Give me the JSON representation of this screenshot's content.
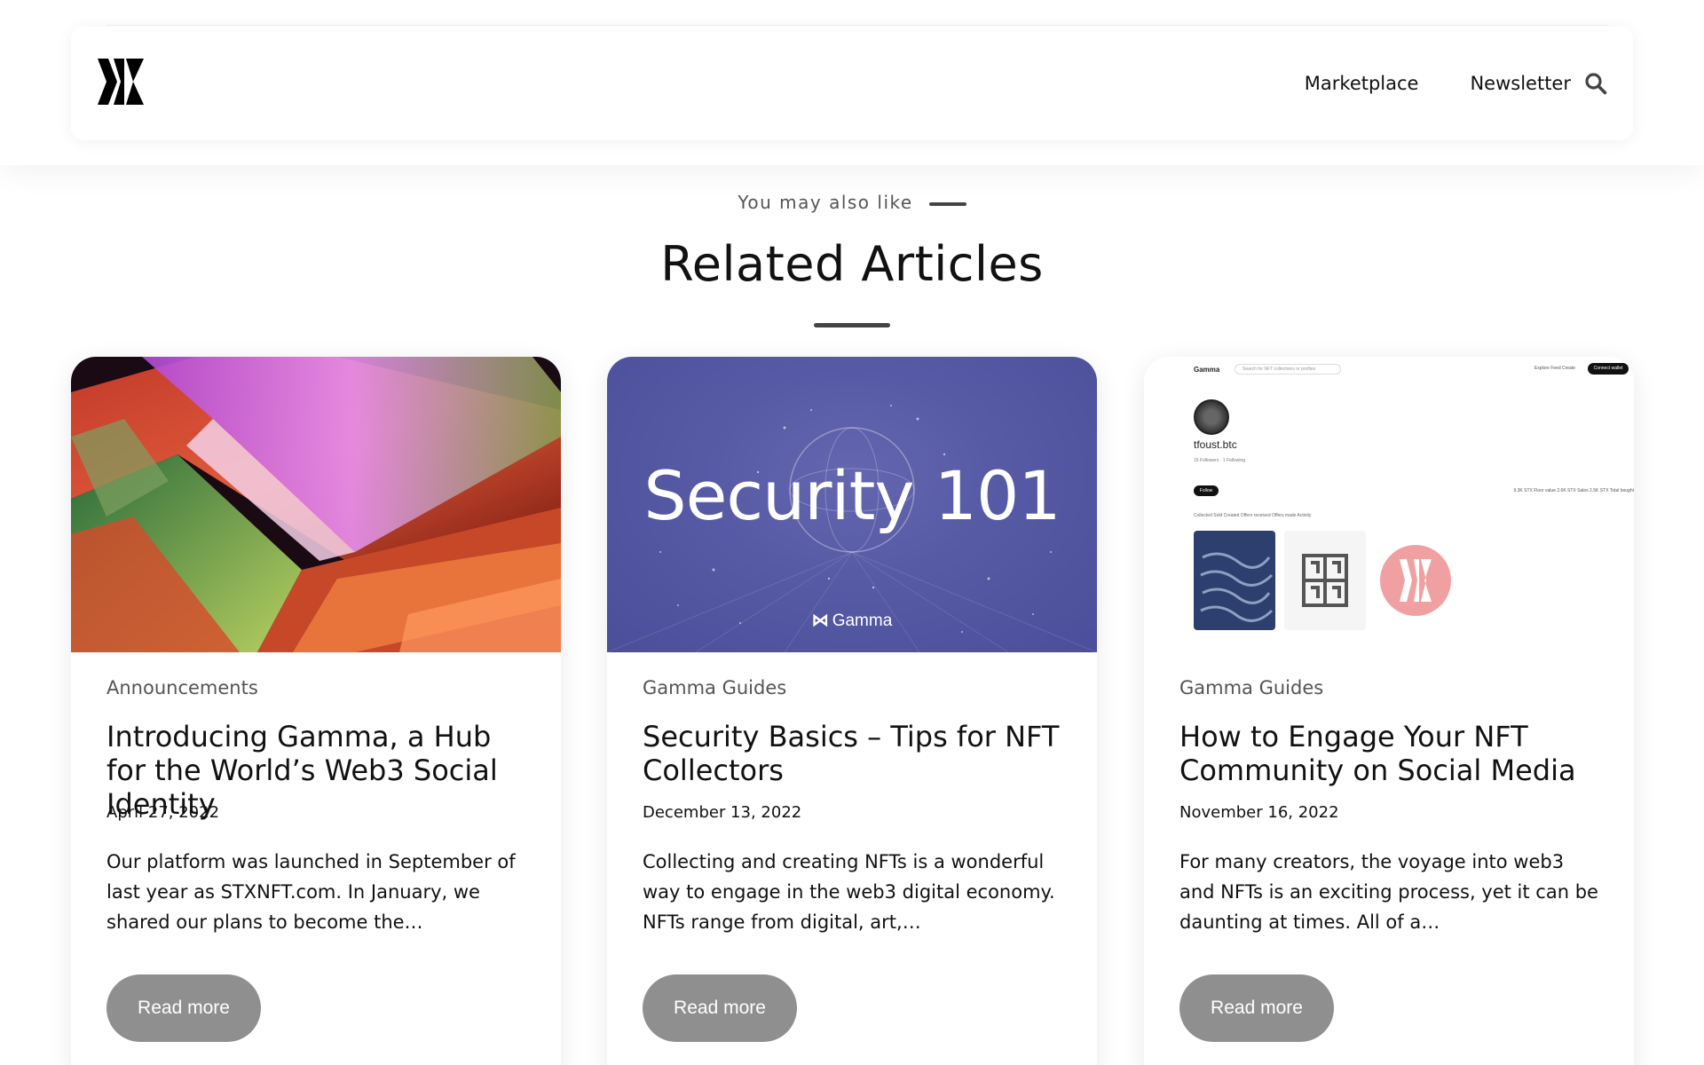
{
  "header": {
    "nav": [
      {
        "label": "Marketplace"
      },
      {
        "label": "Newsletter"
      }
    ]
  },
  "section": {
    "kicker": "You may also like",
    "title": "Related Articles"
  },
  "articles": [
    {
      "category": "Announcements",
      "title": "Introducing Gamma, a Hub for the World’s Web3 Social Identity",
      "date": "April 27, 2022",
      "excerpt": "Our platform was launched in September of last year as STXNFT.com. In January, we shared our plans to become the…",
      "cta": "Read more"
    },
    {
      "category": "Gamma Guides",
      "title": "Security Basics – Tips for NFT Collectors",
      "date": "December 13, 2022",
      "excerpt": "Collecting and creating NFTs is a wonderful way to engage in the web3 digital economy. NFTs range from digital, art,…",
      "cta": "Read more",
      "image_text": {
        "headline": "Security 101",
        "brand": "Gamma"
      }
    },
    {
      "category": "Gamma Guides",
      "title": "How to Engage Your NFT Community on Social Media",
      "date": "November 16, 2022",
      "excerpt": "For many creators, the voyage into web3 and NFTs is an exciting process, yet it can be daunting at times. All of a…",
      "cta": "Read more",
      "image_text": {
        "brand": "Gamma",
        "search_placeholder": "Search for NFT collections or profiles",
        "nav": "Explore   Feed   Create",
        "connect": "Connect wallet",
        "username": "tfoust.btc",
        "meta": "15 Followers · 1 Following",
        "follow": "Follow",
        "stats": "9.3K STX Floor value   2.6K STX Sales   2.5K STX Total bought",
        "tabs": "Collected   Sold   Created   Offers received   Offers made   Activity"
      }
    }
  ],
  "colors": {
    "button_bg": "#8f8f8f",
    "security_bg": "#575aa4",
    "text": "#111111",
    "muted": "#555555"
  },
  "icons": {
    "logo": "gamma-logo-icon",
    "search": "search-icon"
  }
}
